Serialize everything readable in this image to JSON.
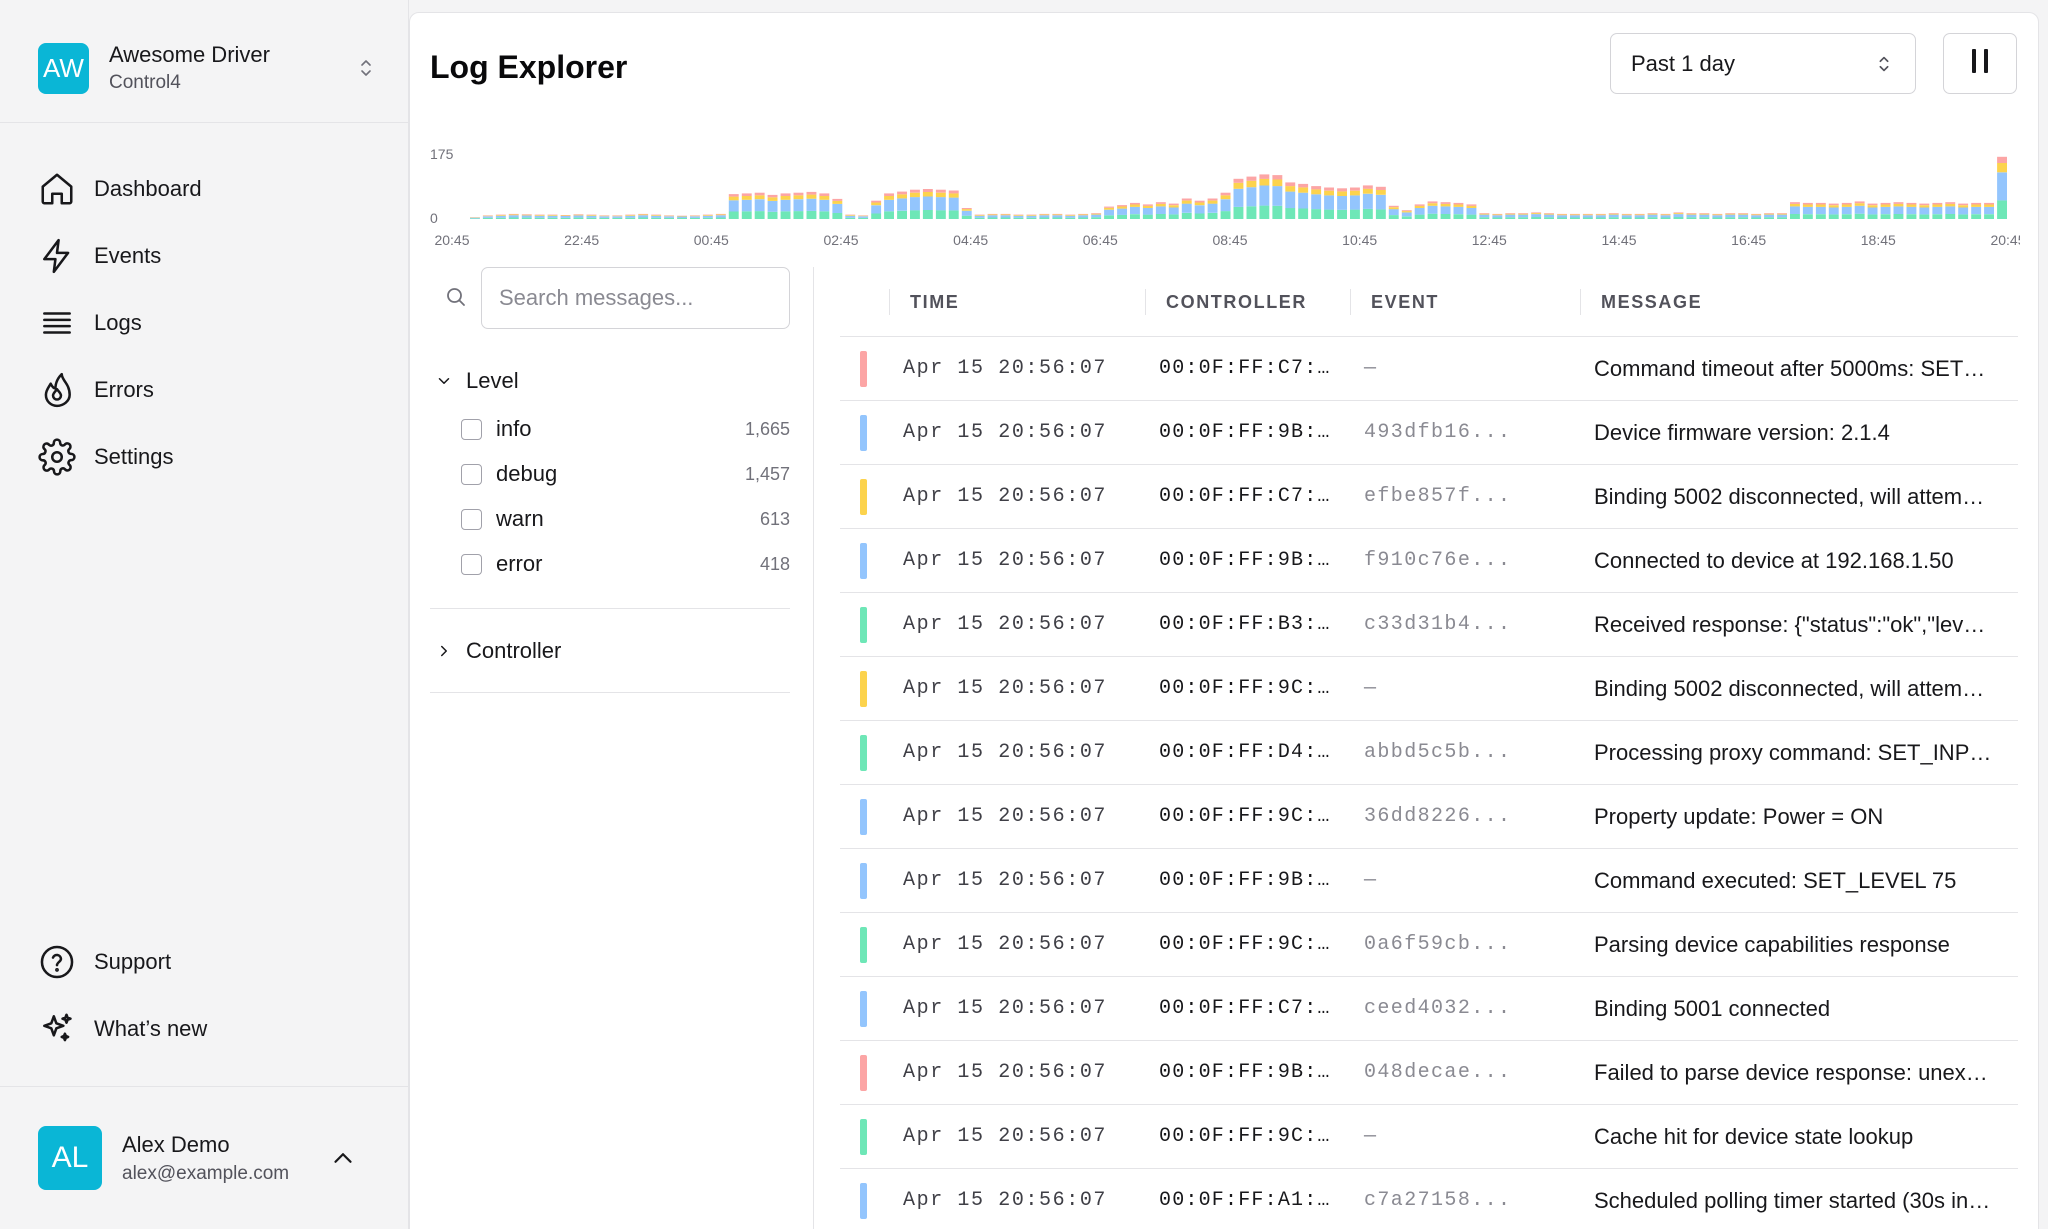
{
  "sidebar": {
    "org": {
      "initials": "AW",
      "name": "Awesome Driver",
      "subtitle": "Control4",
      "switch_icon": "chevron-up-down-icon"
    },
    "nav": [
      {
        "label": "Dashboard",
        "icon": "home-icon"
      },
      {
        "label": "Events",
        "icon": "lightning-icon"
      },
      {
        "label": "Logs",
        "icon": "list-icon"
      },
      {
        "label": "Errors",
        "icon": "flame-icon"
      },
      {
        "label": "Settings",
        "icon": "gear-icon"
      }
    ],
    "bottom_nav": [
      {
        "label": "Support",
        "icon": "help-circle-icon"
      },
      {
        "label": "What’s new",
        "icon": "sparkles-icon"
      }
    ],
    "user": {
      "initials": "AL",
      "name": "Alex Demo",
      "email": "alex@example.com"
    }
  },
  "header": {
    "title": "Log Explorer",
    "range_value": "Past 1 day",
    "pause_icon": "pause-icon"
  },
  "chart_data": {
    "type": "bar",
    "stacked": true,
    "y_ticks": [
      "175",
      "0"
    ],
    "ylim": [
      0,
      175
    ],
    "x_ticks": [
      "20:45",
      "22:45",
      "00:45",
      "02:45",
      "04:45",
      "06:45",
      "08:45",
      "10:45",
      "12:45",
      "14:45",
      "16:45",
      "18:45",
      "20:45"
    ],
    "series_colors": {
      "info": "#6ee7b7",
      "debug": "#93c5fd",
      "warn": "#fcd34d",
      "error": "#fca5a5"
    },
    "totals": [
      5,
      10,
      12,
      14,
      13,
      12,
      12,
      11,
      13,
      12,
      10,
      10,
      12,
      14,
      12,
      10,
      9,
      10,
      12,
      14,
      68,
      70,
      72,
      66,
      70,
      72,
      74,
      70,
      55,
      12,
      10,
      50,
      70,
      75,
      80,
      82,
      80,
      78,
      30,
      12,
      14,
      14,
      12,
      12,
      14,
      14,
      12,
      14,
      16,
      34,
      38,
      44,
      40,
      46,
      42,
      56,
      50,
      56,
      72,
      110,
      116,
      122,
      120,
      100,
      96,
      90,
      86,
      84,
      86,
      92,
      88,
      36,
      24,
      40,
      48,
      46,
      44,
      40,
      16,
      14,
      16,
      16,
      18,
      16,
      14,
      14,
      14,
      14,
      16,
      14,
      14,
      16,
      14,
      18,
      16,
      16,
      14,
      16,
      16,
      14,
      16,
      16,
      46,
      44,
      44,
      42,
      44,
      48,
      42,
      44,
      46,
      44,
      42,
      44,
      46,
      42,
      44,
      44,
      170
    ]
  },
  "filters": {
    "search_placeholder": "Search messages...",
    "level_label": "Level",
    "levels": [
      {
        "name": "info",
        "count": "1,665"
      },
      {
        "name": "debug",
        "count": "1,457"
      },
      {
        "name": "warn",
        "count": "613"
      },
      {
        "name": "error",
        "count": "418"
      }
    ],
    "controller_label": "Controller"
  },
  "table": {
    "columns": [
      "TIME",
      "CONTROLLER",
      "EVENT",
      "MESSAGE"
    ],
    "level_colors": {
      "error": "#fca5a5",
      "debug": "#93c5fd",
      "warn": "#fcd34d",
      "info": "#6ee7b7"
    },
    "rows": [
      {
        "level": "error",
        "time": "Apr 15 20:56:07",
        "controller": "00:0F:FF:C7:…",
        "event": "—",
        "message": "Command timeout after 5000ms: SET…"
      },
      {
        "level": "debug",
        "time": "Apr 15 20:56:07",
        "controller": "00:0F:FF:9B:…",
        "event": "493dfb16...",
        "message": "Device firmware version: 2.1.4"
      },
      {
        "level": "warn",
        "time": "Apr 15 20:56:07",
        "controller": "00:0F:FF:C7:…",
        "event": "efbe857f...",
        "message": "Binding 5002 disconnected, will attem…"
      },
      {
        "level": "debug",
        "time": "Apr 15 20:56:07",
        "controller": "00:0F:FF:9B:…",
        "event": "f910c76e...",
        "message": "Connected to device at 192.168.1.50"
      },
      {
        "level": "info",
        "time": "Apr 15 20:56:07",
        "controller": "00:0F:FF:B3:…",
        "event": "c33d31b4...",
        "message": "Received response: {\"status\":\"ok\",\"lev…"
      },
      {
        "level": "warn",
        "time": "Apr 15 20:56:07",
        "controller": "00:0F:FF:9C:…",
        "event": "—",
        "message": "Binding 5002 disconnected, will attem…"
      },
      {
        "level": "info",
        "time": "Apr 15 20:56:07",
        "controller": "00:0F:FF:D4:…",
        "event": "abbd5c5b...",
        "message": "Processing proxy command: SET_INP…"
      },
      {
        "level": "debug",
        "time": "Apr 15 20:56:07",
        "controller": "00:0F:FF:9C:…",
        "event": "36dd8226...",
        "message": "Property update: Power = ON"
      },
      {
        "level": "debug",
        "time": "Apr 15 20:56:07",
        "controller": "00:0F:FF:9B:…",
        "event": "—",
        "message": "Command executed: SET_LEVEL 75"
      },
      {
        "level": "info",
        "time": "Apr 15 20:56:07",
        "controller": "00:0F:FF:9C:…",
        "event": "0a6f59cb...",
        "message": "Parsing device capabilities response"
      },
      {
        "level": "debug",
        "time": "Apr 15 20:56:07",
        "controller": "00:0F:FF:C7:…",
        "event": "ceed4032...",
        "message": "Binding 5001 connected"
      },
      {
        "level": "error",
        "time": "Apr 15 20:56:07",
        "controller": "00:0F:FF:9B:…",
        "event": "048decae...",
        "message": "Failed to parse device response: unex…"
      },
      {
        "level": "info",
        "time": "Apr 15 20:56:07",
        "controller": "00:0F:FF:9C:…",
        "event": "—",
        "message": "Cache hit for device state lookup"
      },
      {
        "level": "debug",
        "time": "Apr 15 20:56:07",
        "controller": "00:0F:FF:A1:…",
        "event": "c7a27158...",
        "message": "Scheduled polling timer started (30s in…"
      }
    ]
  }
}
